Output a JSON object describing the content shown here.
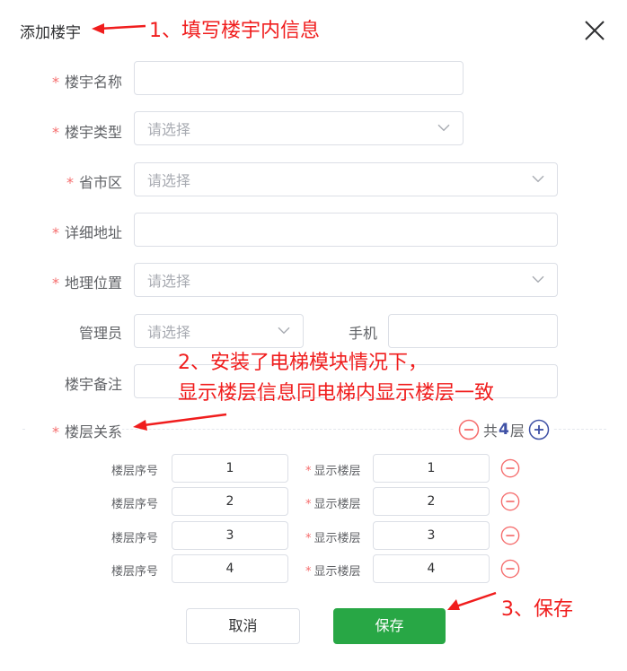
{
  "dialog": {
    "title": "添加楼宇"
  },
  "form": {
    "name_label": "楼宇名称",
    "name_value": "",
    "type_label": "楼宇类型",
    "type_placeholder": "请选择",
    "region_label": "省市区",
    "region_placeholder": "请选择",
    "address_label": "详细地址",
    "address_value": "",
    "geo_label": "地理位置",
    "geo_placeholder": "请选择",
    "admin_label": "管理员",
    "admin_placeholder": "请选择",
    "phone_label": "手机",
    "phone_value": "",
    "remark_label": "楼宇备注",
    "remark_value": "",
    "floors_label": "楼层关系",
    "floors_total_prefix": "共",
    "floors_total": "4",
    "floors_total_suffix": "层"
  },
  "floors": [
    {
      "seq_label": "楼层序号",
      "seq_value": "1",
      "display_label": "显示楼层",
      "display_value": "1"
    },
    {
      "seq_label": "楼层序号",
      "seq_value": "2",
      "display_label": "显示楼层",
      "display_value": "2"
    },
    {
      "seq_label": "楼层序号",
      "seq_value": "3",
      "display_label": "显示楼层",
      "display_value": "3"
    },
    {
      "seq_label": "楼层序号",
      "seq_value": "4",
      "display_label": "显示楼层",
      "display_value": "4"
    }
  ],
  "footer": {
    "cancel_label": "取消",
    "save_label": "保存"
  },
  "annotations": {
    "note1": "1、填写楼宇内信息",
    "note2_line1": "2、安装了电梯模块情况下，",
    "note2_line2": "显示楼层信息同电梯内显示楼层一致",
    "note3": "3、保存"
  },
  "colors": {
    "required": "#f56c6c",
    "primary": "#28a745",
    "annotation": "#f01d1d",
    "floor_accent": "#3f51a5"
  }
}
